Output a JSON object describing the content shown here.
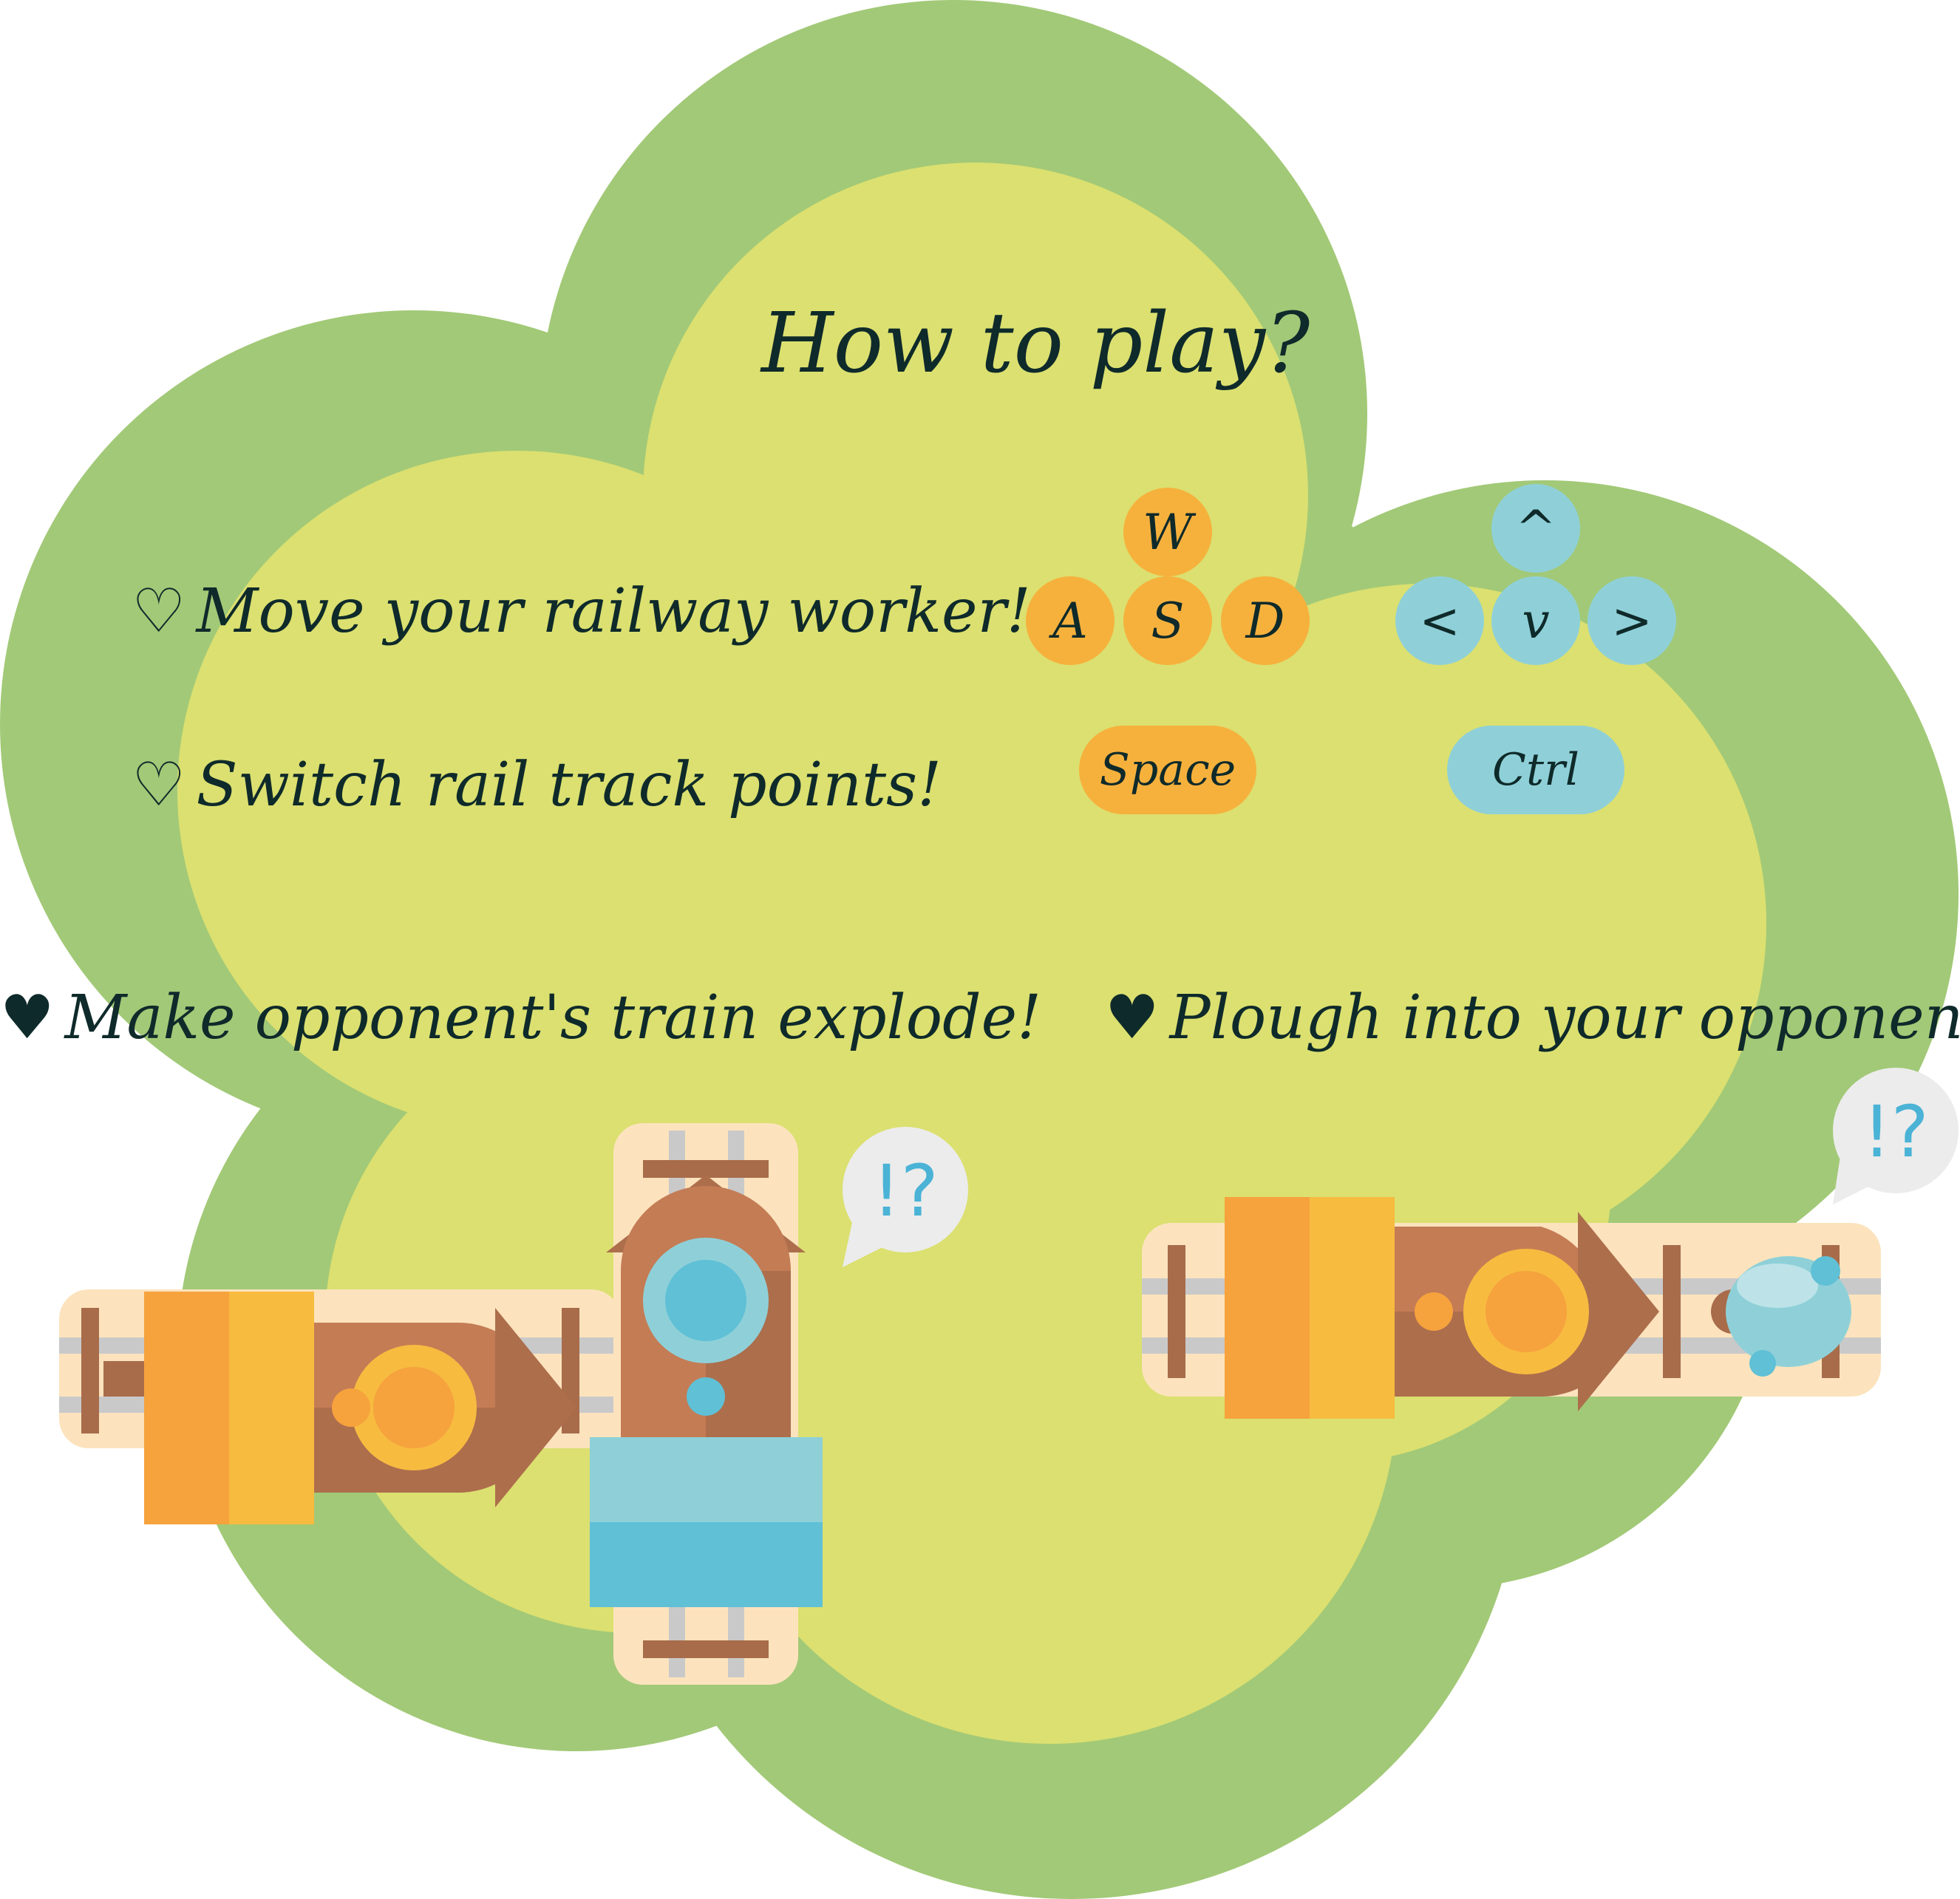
{
  "title": "How to play?",
  "colors": {
    "outer_blob": "#a2c977",
    "inner_blob": "#dbe070",
    "key_orange": "#f6b13d",
    "key_blue": "#8fd0d8",
    "text": "#0f2a2a",
    "bubble_mark": "#4ab3d6"
  },
  "instructions": {
    "move": {
      "icon": "heart-outline-icon",
      "bullet": "♡",
      "text": "Move your railway worker!"
    },
    "switch": {
      "icon": "heart-outline-icon",
      "bullet": "♡",
      "text": "Switch rail track points!"
    },
    "explode": {
      "icon": "heart-filled-icon",
      "bullet": "♥",
      "text": "Make opponent's train explode!"
    },
    "plough": {
      "icon": "heart-filled-icon",
      "bullet": "♥",
      "text": "Plough into your opponent!"
    }
  },
  "player1_keys": {
    "up": "W",
    "left": "A",
    "down": "S",
    "right": "D",
    "action": "Space"
  },
  "player2_keys": {
    "up": "^",
    "left": "<",
    "down": "v",
    "right": ">",
    "action": "Ctrl"
  },
  "bubbles": {
    "left": "!?",
    "right": "!?"
  }
}
